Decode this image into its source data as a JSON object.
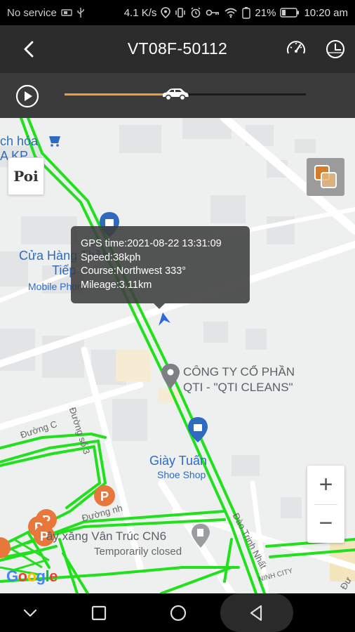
{
  "status_bar": {
    "carrier": "No service",
    "net_speed": "4.1 K/s",
    "battery": "21%",
    "time": "10:20 am"
  },
  "app_bar": {
    "title": "VT08F-50112",
    "back_icon": "back-arrow-icon",
    "speed_icon": "speedometer-icon",
    "clock_icon": "clock-icon"
  },
  "playback": {
    "progress": 0.46,
    "accent_color": "#e8a23c"
  },
  "map": {
    "poi_button": "Poi",
    "info": {
      "gps_time": "GPS time:2021-08-22 13:31:09",
      "speed": "Speed:38kph",
      "course": "Course:Northwest  333°",
      "mileage": "Mileage:3.11km"
    },
    "labels": {
      "hoa": "ch hóa",
      "akp": "A KP",
      "cua_hang": "Cửa Hàng Thần",
      "tiep": "Tiếp",
      "mobile": "Mobile Phon",
      "cong_ty_1": "CÔNG TY CỔ PHẦN",
      "cong_ty_2": "QTI - \"QTI CLEANS\"",
      "duong_so_3": "Đường số 3",
      "duong_c": "Đường C",
      "giay_tuan": "Giày Tuấn",
      "shoe_shop": "Shoe Shop",
      "duong_nho": "Đường nh",
      "xang": "ây xăng Vân Trúc CN6",
      "temp_closed": "Temporarily closed",
      "dao_tri_nhat": "Đào Trinh Nhất",
      "ninh_city": "NINH CITY",
      "du": "Đư"
    },
    "zoom_in": "+",
    "zoom_out": "−",
    "google": "Google",
    "route_color": "#22e01e"
  },
  "nav_bar": {
    "down": "chevron-down-icon",
    "recents": "square-icon",
    "home": "circle-icon",
    "back": "triangle-back-icon"
  }
}
